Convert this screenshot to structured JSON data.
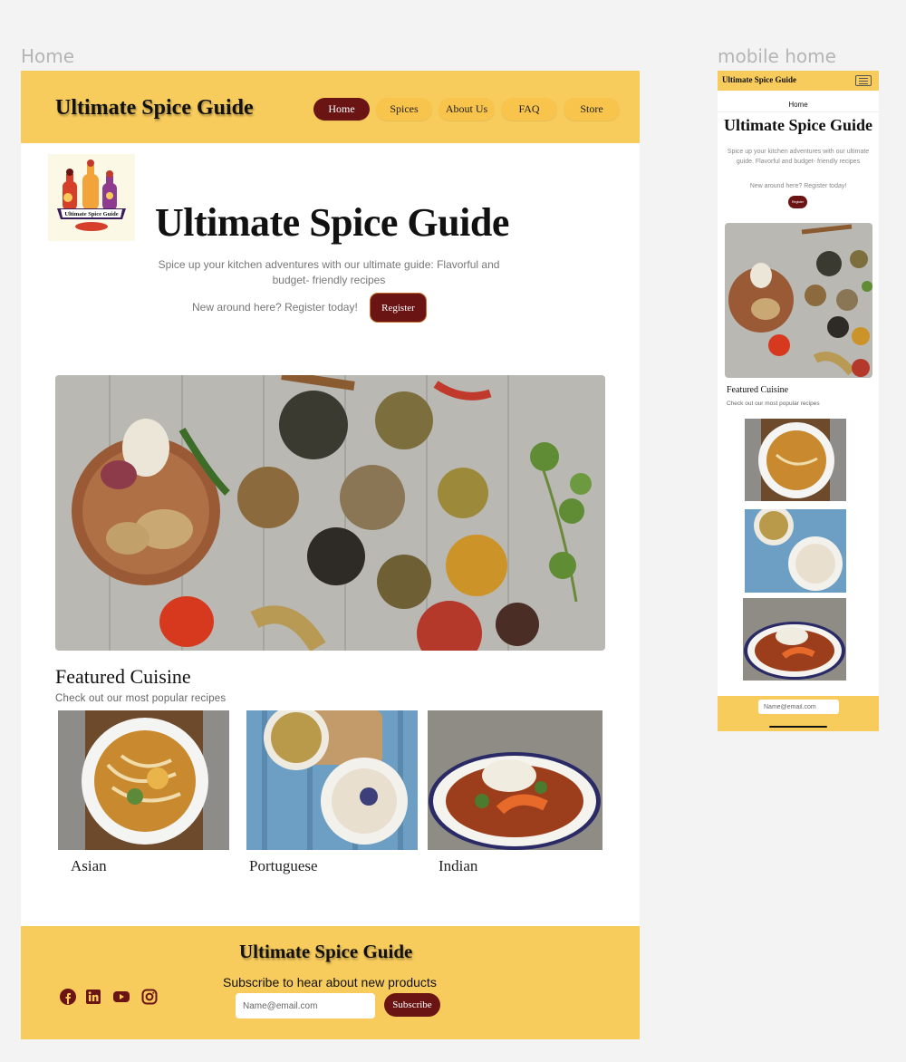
{
  "frames": {
    "desktop_label": "Home",
    "mobile_label": "mobile home"
  },
  "brand": "Ultimate Spice Guide",
  "logo_text": "Ultimate Spice Guide",
  "nav": [
    {
      "label": "Home",
      "active": true
    },
    {
      "label": "Spices",
      "active": false
    },
    {
      "label": "About Us",
      "active": false
    },
    {
      "label": "FAQ",
      "active": false
    },
    {
      "label": "Store",
      "active": false
    }
  ],
  "hero": {
    "title": "Ultimate Spice Guide",
    "subtitle": "Spice up your kitchen adventures with our ultimate guide: Flavorful and budget- friendly recipes",
    "cta_text": "New around here? Register today!",
    "register_label": "Register"
  },
  "featured": {
    "title": "Featured Cuisine",
    "subtitle": "Check out our most popular recipes",
    "cards": [
      {
        "label": "Asian",
        "image": "noodle-soup-bowl"
      },
      {
        "label": "Portuguese",
        "image": "seafood-dish-on-blue-table"
      },
      {
        "label": "Indian",
        "image": "shrimp-curry-with-rice"
      }
    ]
  },
  "footer": {
    "brand": "Ultimate Spice Guide",
    "subscribe_text": "Subscribe to hear about new products",
    "email_placeholder": "Name@email.com",
    "subscribe_label": "Subscribe",
    "social_icons": [
      "facebook-icon",
      "linkedin-icon",
      "youtube-icon",
      "instagram-icon"
    ]
  },
  "mobile": {
    "brand": "Ultimate Spice Guide",
    "nav_current": "Home",
    "title": "Ultimate Spice Guide",
    "subtitle": "Spice up your kitchen adventures with our ultimate guide. Flavorful and budget- friendly recipes",
    "cta_text": "New around here? Register today!",
    "register_label": "Register",
    "featured_title": "Featured Cuisine",
    "featured_subtitle": "Check out our most popular recipes",
    "email_placeholder": "Name@email.com"
  },
  "colors": {
    "accent_yellow": "#f7cb5c",
    "accent_maroon": "#6b1414",
    "background": "#f3f3f3"
  }
}
